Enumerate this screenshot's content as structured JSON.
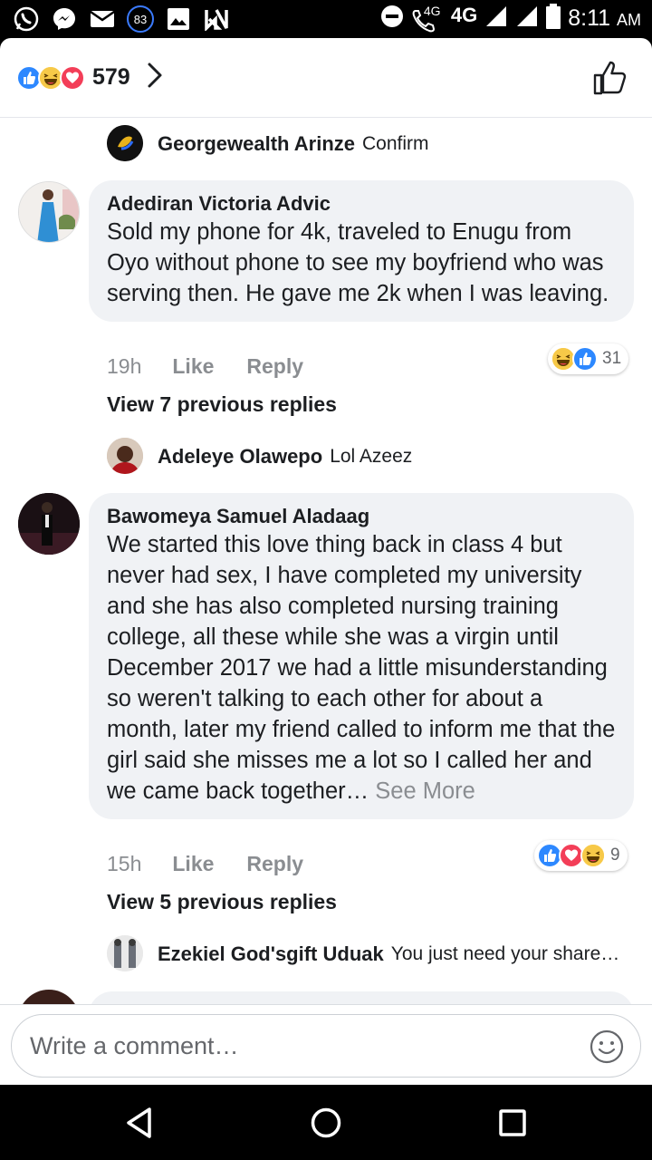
{
  "status_bar": {
    "notification_badge": "83",
    "network_small": "4G",
    "network": "4G",
    "time": "8:11",
    "ampm": "AM"
  },
  "header": {
    "reaction_count": "579"
  },
  "comments": [
    {
      "reply_preview": {
        "name": "Georgewealth Arinze",
        "text": "Confirm"
      }
    },
    {
      "author": "Adediran Victoria Advic",
      "text": "Sold my phone for 4k, traveled to Enugu from Oyo without phone to see my boyfriend who was serving then. He gave me 2k when I was leaving.",
      "time": "19h",
      "like_label": "Like",
      "reply_label": "Reply",
      "reaction_count": "31",
      "view_previous": "View 7 previous replies",
      "reply_preview": {
        "name": "Adeleye Olawepo",
        "text": "Lol Azeez"
      }
    },
    {
      "author": "Bawomeya Samuel Aladaag",
      "text": "We started this love thing back in class 4 but never had sex, I have completed my university and she has also completed nursing training college, all these while she was a virgin until December 2017 we had a little misunderstanding so weren't talking to each other for about a month, later my friend called to inform me that the girl said she misses me a lot so I called her and we came back together…",
      "see_more": "See More",
      "time": "15h",
      "like_label": "Like",
      "reply_label": "Reply",
      "reaction_count": "9",
      "view_previous": "View 5 previous replies",
      "reply_preview": {
        "name": "Ezekiel God'sgift Uduak",
        "text": "You just need your share…"
      }
    }
  ],
  "composer": {
    "placeholder": "Write a comment…"
  },
  "colors": {
    "like_blue": "#2d88ff",
    "love_red": "#f33e58",
    "haha_yellow": "#f7c948",
    "bubble_bg": "#f0f2f5",
    "meta_gray": "#8a8d91"
  },
  "icons": [
    "whatsapp-icon",
    "messenger-icon",
    "mail-icon",
    "gallery-icon",
    "nfc-icon",
    "dnd-icon",
    "volte-call-icon",
    "signal-icon",
    "battery-icon",
    "like-reaction-icon",
    "haha-reaction-icon",
    "love-reaction-icon",
    "chevron-right-icon",
    "thumbs-up-icon",
    "emoji-icon",
    "back-icon",
    "home-icon",
    "recents-icon"
  ]
}
